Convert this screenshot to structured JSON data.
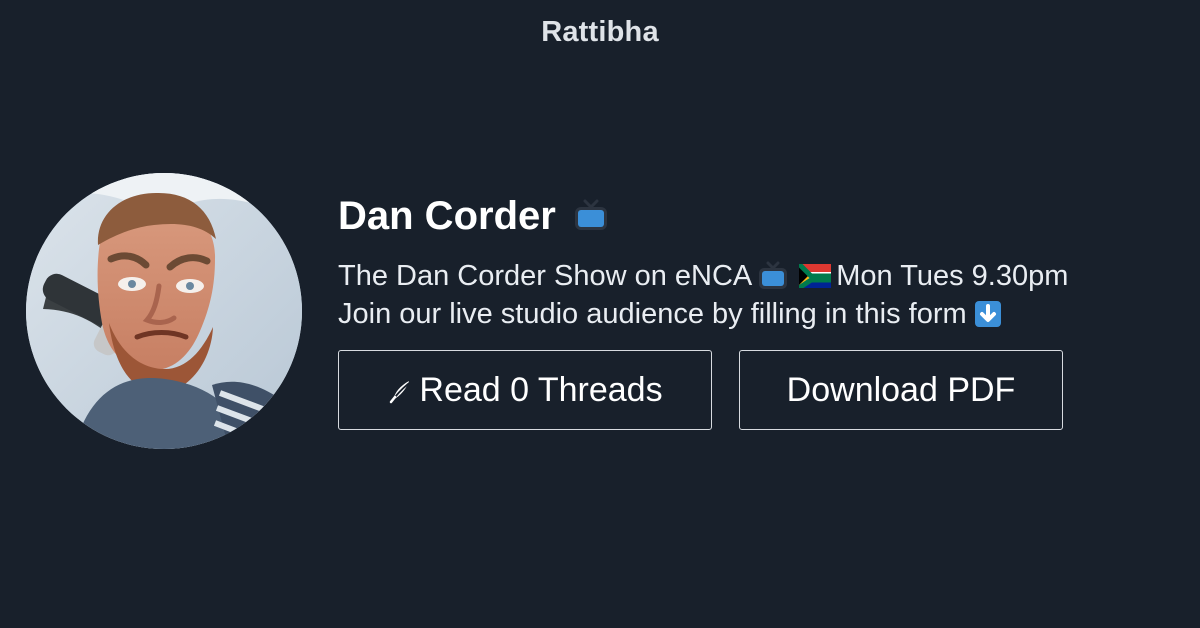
{
  "brand": {
    "name": "Rattibha"
  },
  "profile": {
    "display_name": "Dan Corder",
    "name_icon": "tv-icon",
    "bio": {
      "line1_part1": "The Dan Corder Show on eNCA",
      "line1_icon1": "tv-icon",
      "line1_icon2": "south-africa-flag-icon",
      "line1_part2": "Mon Tues 9.30pm",
      "line2_text": "Join our live studio audience by filling in this form",
      "line2_icon": "down-arrow-icon"
    },
    "avatar": "profile-photo"
  },
  "actions": {
    "read_label": "Read 0 Threads",
    "read_icon": "feather-icon",
    "download_label": "Download PDF"
  },
  "colors": {
    "background": "#18202b",
    "text": "#ffffff",
    "brand_text": "#dfe3e8",
    "button_border": "#d7dbe0",
    "emoji_blue": "#3b8fd8"
  }
}
